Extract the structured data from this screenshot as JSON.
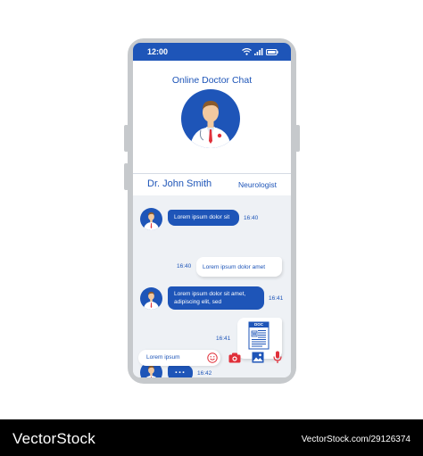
{
  "status_bar": {
    "time": "12:00"
  },
  "header": {
    "title": "Online Doctor Chat",
    "doctor_name": "Dr. John Smith",
    "specialty": "Neurologist"
  },
  "messages": [
    {
      "from": "doctor",
      "text": "Lorem ipsum dolor sit",
      "time": "16:40"
    },
    {
      "from": "user",
      "text": "Lorem ipsum dolor amet",
      "time": "16:40"
    },
    {
      "from": "doctor",
      "line1": "Lorem ipsum dolor sit amet,",
      "line2": "adipiscing elit, sed",
      "time": "16:41"
    },
    {
      "from": "user",
      "attachment": "DOC",
      "time": "16:41"
    },
    {
      "from": "doctor",
      "typing": "...",
      "time": "16:42"
    }
  ],
  "input": {
    "placeholder": "Lorem ipsum"
  },
  "toolbar_icons": [
    "emoji-icon",
    "camera-icon",
    "image-icon",
    "microphone-icon"
  ],
  "colors": {
    "primary": "#1e55b8",
    "accent_red": "#e0303a",
    "background": "#eef1f5"
  },
  "footer": {
    "brand": "VectorStock",
    "credit": "VectorStock.com/29126374"
  }
}
